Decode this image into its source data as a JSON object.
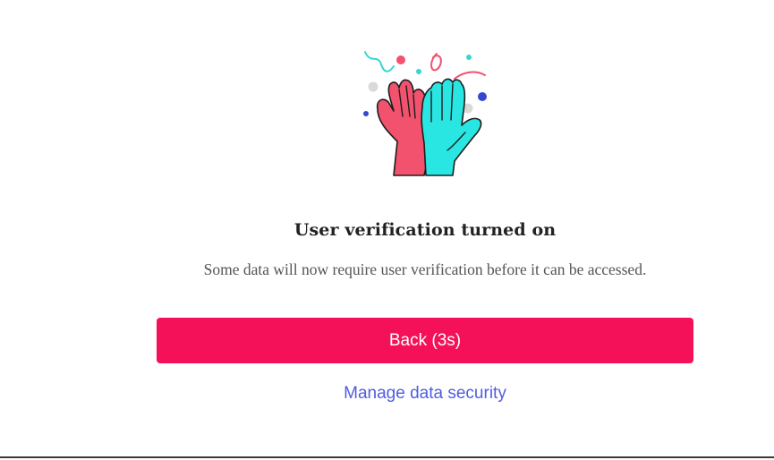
{
  "dialog": {
    "illustration_icon": "high-five-celebration-icon",
    "title": "User verification turned on",
    "message": "Some data will now require user verification before it can be accessed.",
    "back_button_label": "Back (3s)",
    "manage_link_label": "Manage data security"
  },
  "colors": {
    "primary_button": "#f5105a",
    "link": "#4f5de0",
    "left_hand": "#f2526d",
    "right_hand": "#2ae6e3"
  }
}
